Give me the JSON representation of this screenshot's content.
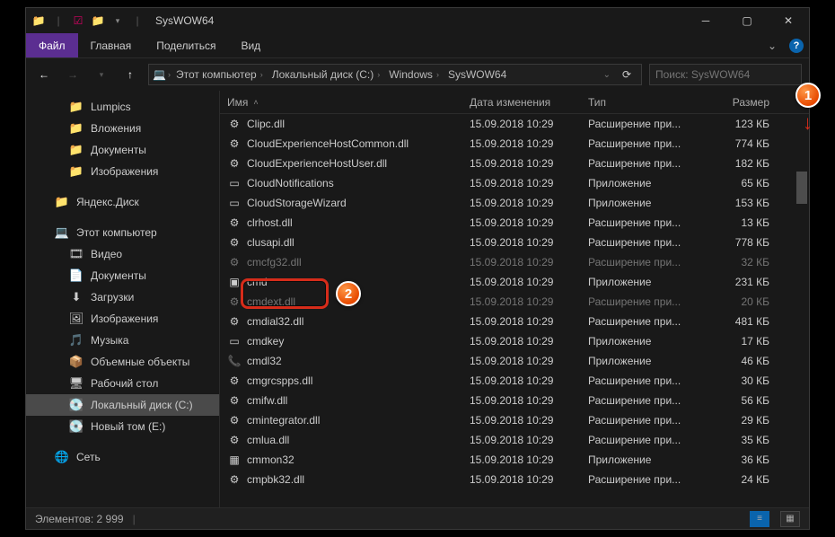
{
  "window": {
    "title": "SysWOW64"
  },
  "ribbon": {
    "file": "Файл",
    "home": "Главная",
    "share": "Поделиться",
    "view": "Вид"
  },
  "nav": {
    "back_enabled": true,
    "fwd_enabled": false,
    "breadcrumbs": [
      "Этот компьютер",
      "Локальный диск (C:)",
      "Windows",
      "SysWOW64"
    ],
    "search_placeholder": "Поиск: SysWOW64"
  },
  "sidebar": {
    "quick": [
      {
        "label": "Lumpics",
        "icon": "📁"
      },
      {
        "label": "Вложения",
        "icon": "📁"
      },
      {
        "label": "Документы",
        "icon": "📁"
      },
      {
        "label": "Изображения",
        "icon": "📁"
      }
    ],
    "yandex": {
      "label": "Яндекс.Диск",
      "icon": "📁"
    },
    "thispc": {
      "label": "Этот компьютер",
      "icon": "💻"
    },
    "thispc_children": [
      {
        "label": "Видео",
        "icon": "🎞"
      },
      {
        "label": "Документы",
        "icon": "📄"
      },
      {
        "label": "Загрузки",
        "icon": "⬇"
      },
      {
        "label": "Изображения",
        "icon": "🖼"
      },
      {
        "label": "Музыка",
        "icon": "🎵"
      },
      {
        "label": "Объемные объекты",
        "icon": "📦"
      },
      {
        "label": "Рабочий стол",
        "icon": "🖥"
      },
      {
        "label": "Локальный диск (C:)",
        "icon": "💽",
        "selected": true
      },
      {
        "label": "Новый том (E:)",
        "icon": "💽"
      }
    ],
    "network": {
      "label": "Сеть",
      "icon": "🌐"
    }
  },
  "columns": {
    "name": "Имя",
    "date": "Дата изменения",
    "type": "Тип",
    "size": "Размер"
  },
  "files": [
    {
      "name": "Clipc.dll",
      "date": "15.09.2018 10:29",
      "type": "Расширение при...",
      "size": "123 КБ",
      "icon": "⚙"
    },
    {
      "name": "CloudExperienceHostCommon.dll",
      "date": "15.09.2018 10:29",
      "type": "Расширение при...",
      "size": "774 КБ",
      "icon": "⚙"
    },
    {
      "name": "CloudExperienceHostUser.dll",
      "date": "15.09.2018 10:29",
      "type": "Расширение при...",
      "size": "182 КБ",
      "icon": "⚙"
    },
    {
      "name": "CloudNotifications",
      "date": "15.09.2018 10:29",
      "type": "Приложение",
      "size": "65 КБ",
      "icon": "▭"
    },
    {
      "name": "CloudStorageWizard",
      "date": "15.09.2018 10:29",
      "type": "Приложение",
      "size": "153 КБ",
      "icon": "▭"
    },
    {
      "name": "clrhost.dll",
      "date": "15.09.2018 10:29",
      "type": "Расширение при...",
      "size": "13 КБ",
      "icon": "⚙"
    },
    {
      "name": "clusapi.dll",
      "date": "15.09.2018 10:29",
      "type": "Расширение при...",
      "size": "778 КБ",
      "icon": "⚙"
    },
    {
      "name": "cmcfg32.dll",
      "date": "15.09.2018 10:29",
      "type": "Расширение при...",
      "size": "32 КБ",
      "icon": "⚙",
      "dim": true
    },
    {
      "name": "cmd",
      "date": "15.09.2018 10:29",
      "type": "Приложение",
      "size": "231 КБ",
      "icon": "▣",
      "highlight": true
    },
    {
      "name": "cmdext.dll",
      "date": "15.09.2018 10:29",
      "type": "Расширение при...",
      "size": "20 КБ",
      "icon": "⚙",
      "dim": true
    },
    {
      "name": "cmdial32.dll",
      "date": "15.09.2018 10:29",
      "type": "Расширение при...",
      "size": "481 КБ",
      "icon": "⚙"
    },
    {
      "name": "cmdkey",
      "date": "15.09.2018 10:29",
      "type": "Приложение",
      "size": "17 КБ",
      "icon": "▭"
    },
    {
      "name": "cmdl32",
      "date": "15.09.2018 10:29",
      "type": "Приложение",
      "size": "46 КБ",
      "icon": "📞"
    },
    {
      "name": "cmgrcspps.dll",
      "date": "15.09.2018 10:29",
      "type": "Расширение при...",
      "size": "30 КБ",
      "icon": "⚙"
    },
    {
      "name": "cmifw.dll",
      "date": "15.09.2018 10:29",
      "type": "Расширение при...",
      "size": "56 КБ",
      "icon": "⚙"
    },
    {
      "name": "cmintegrator.dll",
      "date": "15.09.2018 10:29",
      "type": "Расширение при...",
      "size": "29 КБ",
      "icon": "⚙"
    },
    {
      "name": "cmlua.dll",
      "date": "15.09.2018 10:29",
      "type": "Расширение при...",
      "size": "35 КБ",
      "icon": "⚙"
    },
    {
      "name": "cmmon32",
      "date": "15.09.2018 10:29",
      "type": "Приложение",
      "size": "36 КБ",
      "icon": "▦"
    },
    {
      "name": "cmpbk32.dll",
      "date": "15.09.2018 10:29",
      "type": "Расширение при...",
      "size": "24 КБ",
      "icon": "⚙"
    }
  ],
  "status": {
    "count_label": "Элементов: 2 999"
  },
  "callouts": {
    "one": "1",
    "two": "2"
  }
}
